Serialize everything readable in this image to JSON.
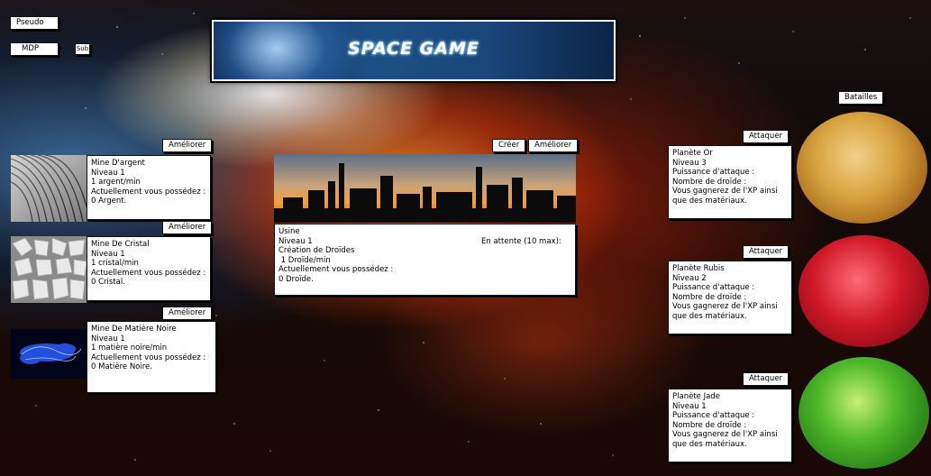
{
  "login": {
    "username_label": "Pseudo",
    "password_label": "MDP",
    "submit_label": "Sub"
  },
  "header": {
    "title": "SPACE GAME"
  },
  "battles_button": "Batailles",
  "mines": [
    {
      "upgrade_label": "Améliorer",
      "name": "Mine D'argent",
      "level": "Niveau 1",
      "rate": "1 argent/min",
      "owned_label": "Actuellement vous possédez :",
      "owned_value": "0 Argent.",
      "image": "silver-texture"
    },
    {
      "upgrade_label": "Améliorer",
      "name": "Mine De Cristal",
      "level": "Niveau 1",
      "rate": "1 cristal/min",
      "owned_label": "Actuellement vous possédez :",
      "owned_value": "0 Cristal.",
      "image": "crystal-rocks"
    },
    {
      "upgrade_label": "Améliorer",
      "name": "Mine De Matière Noire",
      "level": "Niveau 1",
      "rate": "1 matière noire/min",
      "owned_label": "Actuellement vous possédez :",
      "owned_value": "0 Matière Noire.",
      "image": "dark-matter"
    }
  ],
  "factory": {
    "create_label": "Créer",
    "upgrade_label": "Améliorer",
    "name": "Usine",
    "level": "Niveau 1",
    "creation_label": "Création de Droïdes",
    "rate": " 1 Droïde/min",
    "owned_label": "Actuellement vous possédez :",
    "owned_value": "0 Droïde.",
    "queue_label": "En attente (10 max):"
  },
  "planets": [
    {
      "attack_label": "Attaquer",
      "name": "Planète Or",
      "level": "Niveau 3",
      "power_label": "Puissance d'attaque :",
      "droids_label": "Nombre de droïde :",
      "reward_line1": "Vous gagnerez de l'XP ainsi",
      "reward_line2": "que des matériaux.",
      "color": "#d9a441"
    },
    {
      "attack_label": "Attaquer",
      "name": "Planète Rubis",
      "level": "Niveau 2",
      "power_label": "Puissance d'attaque :",
      "droids_label": "Nombre de droïde :",
      "reward_line1": "Vous gagnerez de l'XP ainsi",
      "reward_line2": "que des matériaux.",
      "color": "#d01828"
    },
    {
      "attack_label": "Attaquer",
      "name": "Planète Jade",
      "level": "Niveau 1",
      "power_label": "Puissance d'attaque :",
      "droids_label": "Nombre de droïde :",
      "reward_line1": "Vous gagnerez de l'XP ainsi",
      "reward_line2": "que des matériaux.",
      "color": "#4fb82a"
    }
  ]
}
